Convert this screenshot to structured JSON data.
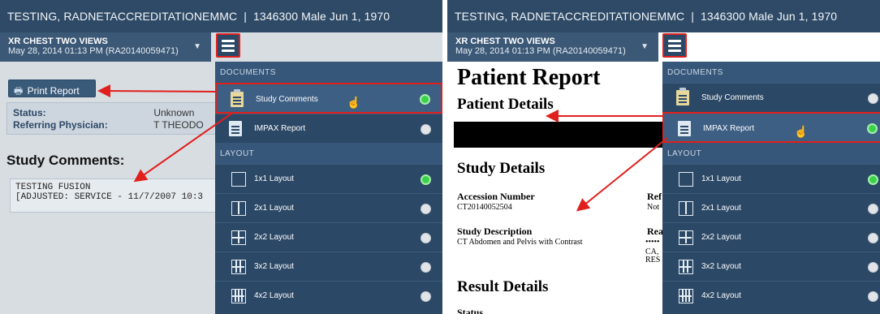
{
  "left": {
    "header": {
      "patient_name": "TESTING, RADNETACCREDITATIONEMMC",
      "separator": "|",
      "patient_info": "1346300 Male Jun 1, 1970"
    },
    "study": {
      "name": "XR CHEST TWO VIEWS",
      "date": "May 28, 2014 01:13 PM (RA20140059471)",
      "caret": "▼"
    },
    "print_label": "Print Report",
    "print_glyph": "🖶",
    "status_label": "Status:",
    "status_value": "Unknown",
    "referring_label": "Referring Physician:",
    "referring_value": "T THEODO",
    "comments_title": "Study Comments:",
    "comment_line1": "TESTING FUSION",
    "comment_line2": "[ADJUSTED: SERVICE - 11/7/2007 10:3",
    "menu": {
      "documents_header": "DOCUMENTS",
      "layout_header": "LAYOUT",
      "documents": [
        {
          "label": "Study Comments",
          "on": true,
          "icon": "clipboard-icon"
        },
        {
          "label": "IMPAX Report",
          "on": false,
          "icon": "document-icon"
        }
      ],
      "layouts": [
        {
          "label": "1x1 Layout",
          "on": true
        },
        {
          "label": "2x1 Layout",
          "on": false
        },
        {
          "label": "2x2 Layout",
          "on": false
        },
        {
          "label": "3x2 Layout",
          "on": false
        },
        {
          "label": "4x2 Layout",
          "on": false
        }
      ]
    }
  },
  "right": {
    "header": {
      "patient_name": "TESTING, RADNETACCREDITATIONEMMC",
      "separator": "|",
      "patient_info": "1346300 Male Jun 1, 1970"
    },
    "study": {
      "name": "XR CHEST TWO VIEWS",
      "date": "May 28, 2014 01:13 PM (RA20140059471)",
      "caret": "▼"
    },
    "report": {
      "title": "Patient Report",
      "patient_details": "Patient Details",
      "study_details": "Study Details",
      "accession_label": "Accession Number",
      "accession_value": "CT20140052504",
      "description_label": "Study Description",
      "description_value": "CT Abdomen and Pelvis with Contrast",
      "result_details": "Result Details",
      "status_cut": "Status",
      "ref_cut": "Ref",
      "not_cut": "Not",
      "rea_cut": "Rea",
      "dots_cut": "•••••",
      "ca_cut": "CA,",
      "res_cut": "RES"
    },
    "menu": {
      "documents_header": "DOCUMENTS",
      "layout_header": "LAYOUT",
      "documents": [
        {
          "label": "Study Comments",
          "on": false,
          "icon": "clipboard-icon"
        },
        {
          "label": "IMPAX Report",
          "on": true,
          "icon": "document-icon"
        }
      ],
      "layouts": [
        {
          "label": "1x1 Layout",
          "on": true
        },
        {
          "label": "2x1 Layout",
          "on": false
        },
        {
          "label": "2x2 Layout",
          "on": false
        },
        {
          "label": "3x2 Layout",
          "on": false
        },
        {
          "label": "4x2 Layout",
          "on": false
        }
      ]
    }
  },
  "colors": {
    "header_bg": "#2e4a66",
    "menu_bg": "#2b4866",
    "highlight": "#e0201c",
    "toggle_on": "#3bd24b"
  }
}
